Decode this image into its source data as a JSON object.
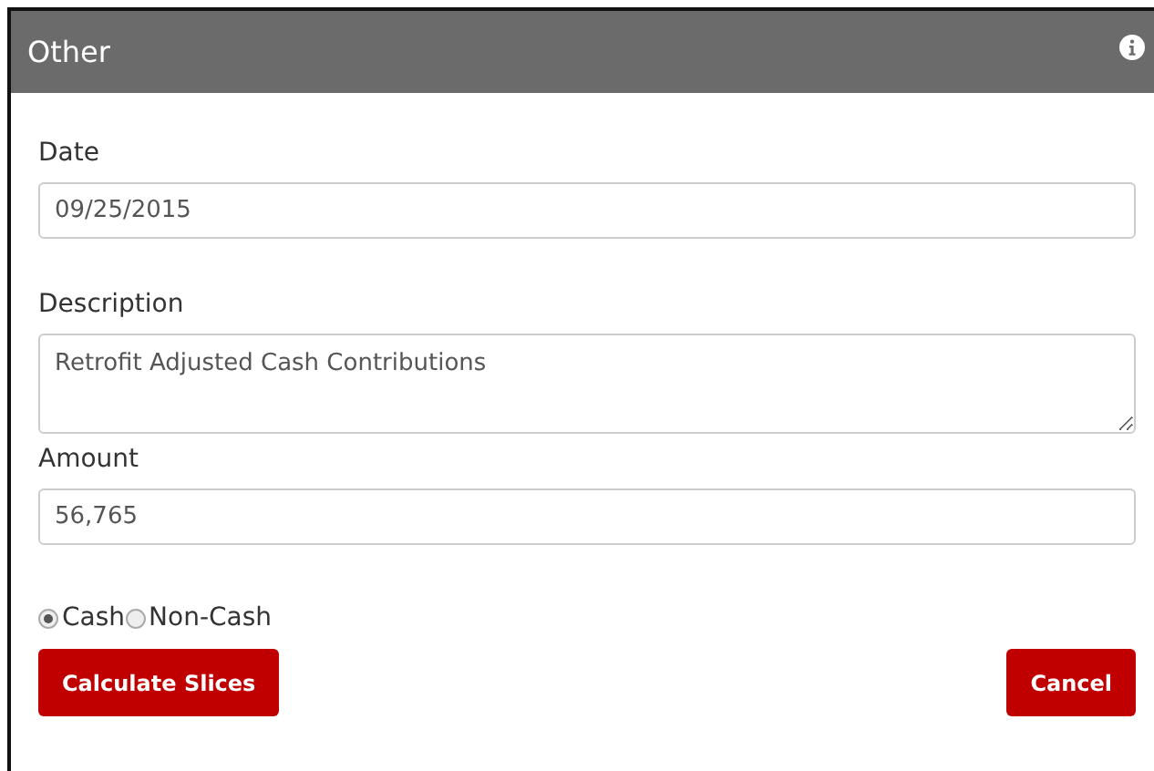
{
  "panel": {
    "title": "Other"
  },
  "fields": [
    {
      "label": "Date",
      "kind": "input",
      "value": "09/25/2015"
    },
    {
      "label": "Description",
      "kind": "textarea",
      "value": "Retrofit Adjusted Cash Contributions"
    },
    {
      "label": "Amount",
      "kind": "input",
      "value": "56,765"
    }
  ],
  "payment_type": [
    {
      "label": "Cash",
      "selected": true
    },
    {
      "label": "Non-Cash",
      "selected": false
    }
  ],
  "buttons": [
    {
      "label": "Calculate Slices"
    },
    {
      "label": "Cancel"
    }
  ]
}
